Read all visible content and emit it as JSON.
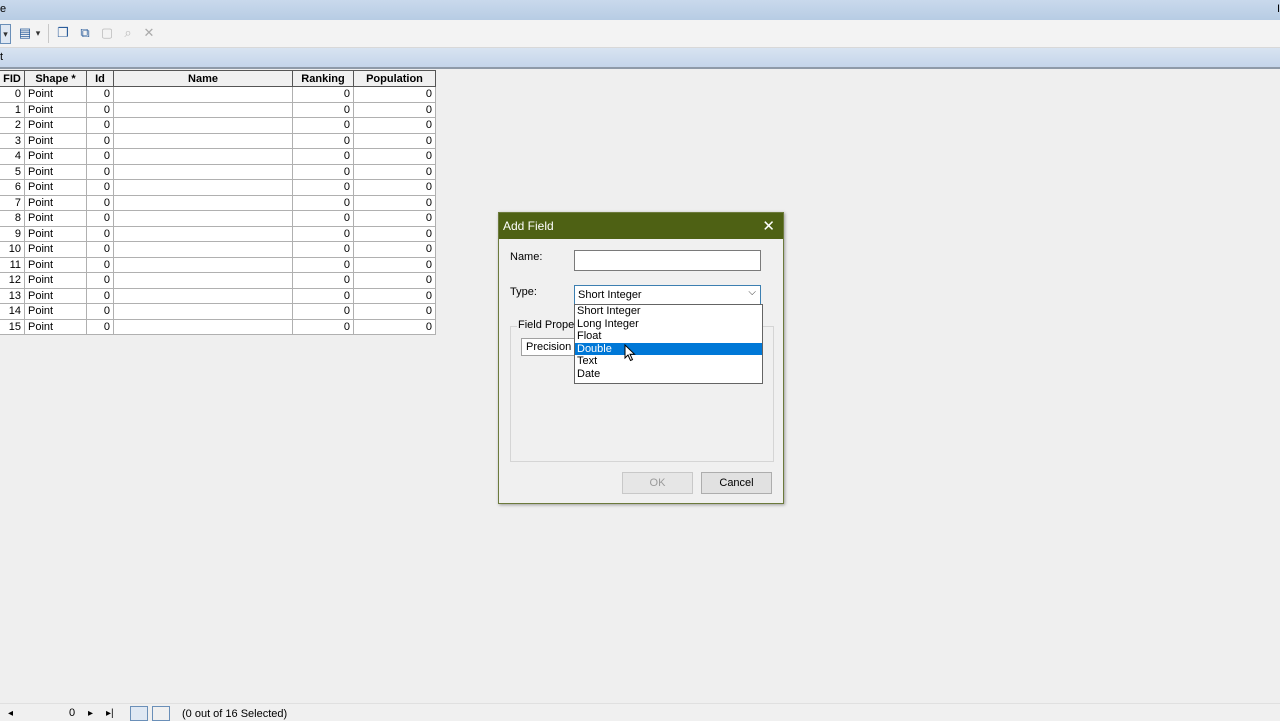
{
  "window": {
    "title_fragment": "e",
    "right_fragment": "I"
  },
  "tab": {
    "label": "t"
  },
  "table": {
    "columns": [
      "FID",
      "Shape *",
      "Id",
      "Name",
      "Ranking",
      "Population"
    ],
    "rows": [
      [
        "0",
        "Point",
        "0",
        "",
        "0",
        "0"
      ],
      [
        "1",
        "Point",
        "0",
        "",
        "0",
        "0"
      ],
      [
        "2",
        "Point",
        "0",
        "",
        "0",
        "0"
      ],
      [
        "3",
        "Point",
        "0",
        "",
        "0",
        "0"
      ],
      [
        "4",
        "Point",
        "0",
        "",
        "0",
        "0"
      ],
      [
        "5",
        "Point",
        "0",
        "",
        "0",
        "0"
      ],
      [
        "6",
        "Point",
        "0",
        "",
        "0",
        "0"
      ],
      [
        "7",
        "Point",
        "0",
        "",
        "0",
        "0"
      ],
      [
        "8",
        "Point",
        "0",
        "",
        "0",
        "0"
      ],
      [
        "9",
        "Point",
        "0",
        "",
        "0",
        "0"
      ],
      [
        "10",
        "Point",
        "0",
        "",
        "0",
        "0"
      ],
      [
        "11",
        "Point",
        "0",
        "",
        "0",
        "0"
      ],
      [
        "12",
        "Point",
        "0",
        "",
        "0",
        "0"
      ],
      [
        "13",
        "Point",
        "0",
        "",
        "0",
        "0"
      ],
      [
        "14",
        "Point",
        "0",
        "",
        "0",
        "0"
      ],
      [
        "15",
        "Point",
        "0",
        "",
        "0",
        "0"
      ]
    ]
  },
  "dialog": {
    "title": "Add Field",
    "name_label": "Name:",
    "name_value": "",
    "type_label": "Type:",
    "type_value": "Short Integer",
    "field_properties_label": "Field Proper",
    "precision_label": "Precision",
    "type_options": [
      "Short Integer",
      "Long Integer",
      "Float",
      "Double",
      "Text",
      "Date"
    ],
    "highlighted_option": "Double",
    "ok_label": "OK",
    "cancel_label": "Cancel"
  },
  "status": {
    "record": "0",
    "selection_text": "(0 out of 16 Selected)"
  },
  "colors": {
    "dialog_title_bg": "#4e6114",
    "selection_bg": "#0078d7"
  }
}
